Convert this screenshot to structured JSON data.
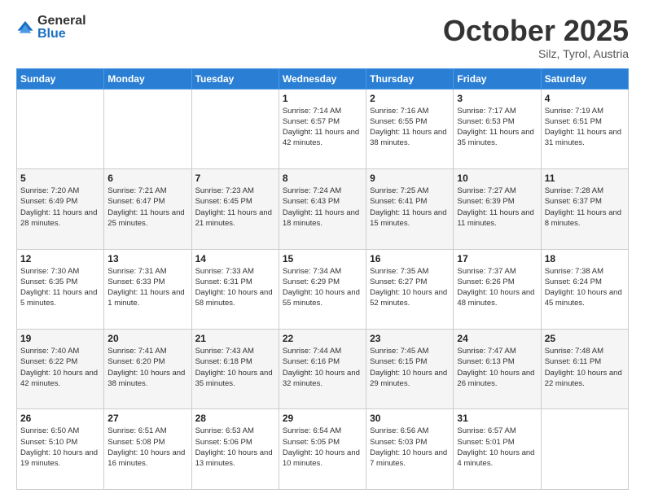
{
  "logo": {
    "general": "General",
    "blue": "Blue"
  },
  "header": {
    "month": "October 2025",
    "location": "Silz, Tyrol, Austria"
  },
  "weekdays": [
    "Sunday",
    "Monday",
    "Tuesday",
    "Wednesday",
    "Thursday",
    "Friday",
    "Saturday"
  ],
  "weeks": [
    [
      {
        "day": "",
        "sunrise": "",
        "sunset": "",
        "daylight": ""
      },
      {
        "day": "",
        "sunrise": "",
        "sunset": "",
        "daylight": ""
      },
      {
        "day": "",
        "sunrise": "",
        "sunset": "",
        "daylight": ""
      },
      {
        "day": "1",
        "sunrise": "Sunrise: 7:14 AM",
        "sunset": "Sunset: 6:57 PM",
        "daylight": "Daylight: 11 hours and 42 minutes."
      },
      {
        "day": "2",
        "sunrise": "Sunrise: 7:16 AM",
        "sunset": "Sunset: 6:55 PM",
        "daylight": "Daylight: 11 hours and 38 minutes."
      },
      {
        "day": "3",
        "sunrise": "Sunrise: 7:17 AM",
        "sunset": "Sunset: 6:53 PM",
        "daylight": "Daylight: 11 hours and 35 minutes."
      },
      {
        "day": "4",
        "sunrise": "Sunrise: 7:19 AM",
        "sunset": "Sunset: 6:51 PM",
        "daylight": "Daylight: 11 hours and 31 minutes."
      }
    ],
    [
      {
        "day": "5",
        "sunrise": "Sunrise: 7:20 AM",
        "sunset": "Sunset: 6:49 PM",
        "daylight": "Daylight: 11 hours and 28 minutes."
      },
      {
        "day": "6",
        "sunrise": "Sunrise: 7:21 AM",
        "sunset": "Sunset: 6:47 PM",
        "daylight": "Daylight: 11 hours and 25 minutes."
      },
      {
        "day": "7",
        "sunrise": "Sunrise: 7:23 AM",
        "sunset": "Sunset: 6:45 PM",
        "daylight": "Daylight: 11 hours and 21 minutes."
      },
      {
        "day": "8",
        "sunrise": "Sunrise: 7:24 AM",
        "sunset": "Sunset: 6:43 PM",
        "daylight": "Daylight: 11 hours and 18 minutes."
      },
      {
        "day": "9",
        "sunrise": "Sunrise: 7:25 AM",
        "sunset": "Sunset: 6:41 PM",
        "daylight": "Daylight: 11 hours and 15 minutes."
      },
      {
        "day": "10",
        "sunrise": "Sunrise: 7:27 AM",
        "sunset": "Sunset: 6:39 PM",
        "daylight": "Daylight: 11 hours and 11 minutes."
      },
      {
        "day": "11",
        "sunrise": "Sunrise: 7:28 AM",
        "sunset": "Sunset: 6:37 PM",
        "daylight": "Daylight: 11 hours and 8 minutes."
      }
    ],
    [
      {
        "day": "12",
        "sunrise": "Sunrise: 7:30 AM",
        "sunset": "Sunset: 6:35 PM",
        "daylight": "Daylight: 11 hours and 5 minutes."
      },
      {
        "day": "13",
        "sunrise": "Sunrise: 7:31 AM",
        "sunset": "Sunset: 6:33 PM",
        "daylight": "Daylight: 11 hours and 1 minute."
      },
      {
        "day": "14",
        "sunrise": "Sunrise: 7:33 AM",
        "sunset": "Sunset: 6:31 PM",
        "daylight": "Daylight: 10 hours and 58 minutes."
      },
      {
        "day": "15",
        "sunrise": "Sunrise: 7:34 AM",
        "sunset": "Sunset: 6:29 PM",
        "daylight": "Daylight: 10 hours and 55 minutes."
      },
      {
        "day": "16",
        "sunrise": "Sunrise: 7:35 AM",
        "sunset": "Sunset: 6:27 PM",
        "daylight": "Daylight: 10 hours and 52 minutes."
      },
      {
        "day": "17",
        "sunrise": "Sunrise: 7:37 AM",
        "sunset": "Sunset: 6:26 PM",
        "daylight": "Daylight: 10 hours and 48 minutes."
      },
      {
        "day": "18",
        "sunrise": "Sunrise: 7:38 AM",
        "sunset": "Sunset: 6:24 PM",
        "daylight": "Daylight: 10 hours and 45 minutes."
      }
    ],
    [
      {
        "day": "19",
        "sunrise": "Sunrise: 7:40 AM",
        "sunset": "Sunset: 6:22 PM",
        "daylight": "Daylight: 10 hours and 42 minutes."
      },
      {
        "day": "20",
        "sunrise": "Sunrise: 7:41 AM",
        "sunset": "Sunset: 6:20 PM",
        "daylight": "Daylight: 10 hours and 38 minutes."
      },
      {
        "day": "21",
        "sunrise": "Sunrise: 7:43 AM",
        "sunset": "Sunset: 6:18 PM",
        "daylight": "Daylight: 10 hours and 35 minutes."
      },
      {
        "day": "22",
        "sunrise": "Sunrise: 7:44 AM",
        "sunset": "Sunset: 6:16 PM",
        "daylight": "Daylight: 10 hours and 32 minutes."
      },
      {
        "day": "23",
        "sunrise": "Sunrise: 7:45 AM",
        "sunset": "Sunset: 6:15 PM",
        "daylight": "Daylight: 10 hours and 29 minutes."
      },
      {
        "day": "24",
        "sunrise": "Sunrise: 7:47 AM",
        "sunset": "Sunset: 6:13 PM",
        "daylight": "Daylight: 10 hours and 26 minutes."
      },
      {
        "day": "25",
        "sunrise": "Sunrise: 7:48 AM",
        "sunset": "Sunset: 6:11 PM",
        "daylight": "Daylight: 10 hours and 22 minutes."
      }
    ],
    [
      {
        "day": "26",
        "sunrise": "Sunrise: 6:50 AM",
        "sunset": "Sunset: 5:10 PM",
        "daylight": "Daylight: 10 hours and 19 minutes."
      },
      {
        "day": "27",
        "sunrise": "Sunrise: 6:51 AM",
        "sunset": "Sunset: 5:08 PM",
        "daylight": "Daylight: 10 hours and 16 minutes."
      },
      {
        "day": "28",
        "sunrise": "Sunrise: 6:53 AM",
        "sunset": "Sunset: 5:06 PM",
        "daylight": "Daylight: 10 hours and 13 minutes."
      },
      {
        "day": "29",
        "sunrise": "Sunrise: 6:54 AM",
        "sunset": "Sunset: 5:05 PM",
        "daylight": "Daylight: 10 hours and 10 minutes."
      },
      {
        "day": "30",
        "sunrise": "Sunrise: 6:56 AM",
        "sunset": "Sunset: 5:03 PM",
        "daylight": "Daylight: 10 hours and 7 minutes."
      },
      {
        "day": "31",
        "sunrise": "Sunrise: 6:57 AM",
        "sunset": "Sunset: 5:01 PM",
        "daylight": "Daylight: 10 hours and 4 minutes."
      },
      {
        "day": "",
        "sunrise": "",
        "sunset": "",
        "daylight": ""
      }
    ]
  ]
}
